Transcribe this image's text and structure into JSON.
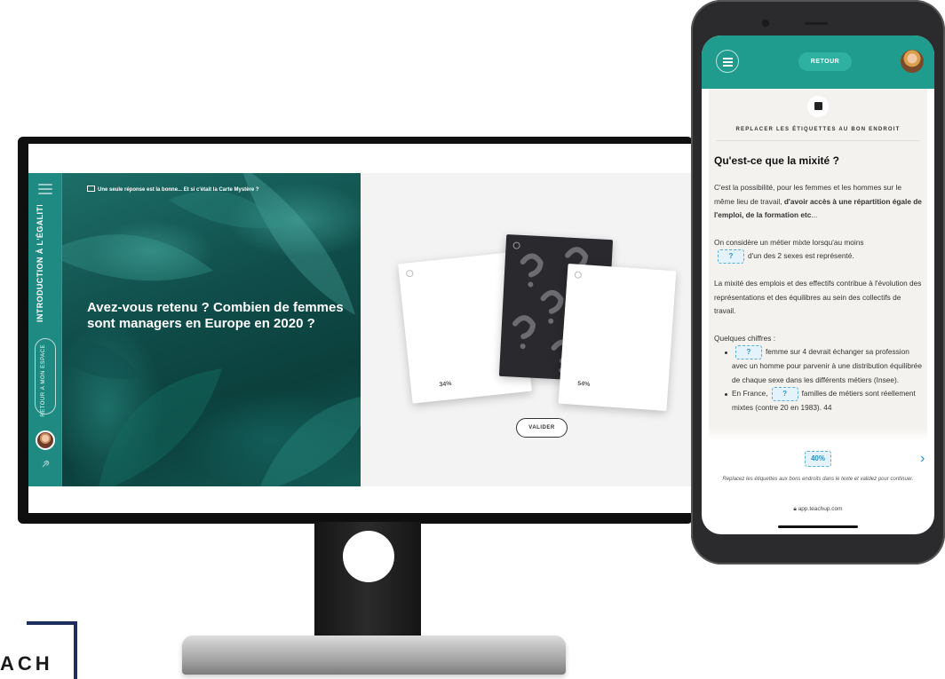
{
  "monitor": {
    "sidebar": {
      "course_title": "INTRODUCTION À L'ÉGALITÉ ...",
      "return_label": "RETOUR À MON ESPACE"
    },
    "slide": {
      "hint": "Une seule réponse est la bonne... Et si c'était la Carte Mystère ?",
      "question": "Avez-vous retenu ? Combien de femmes sont managers en Europe en 2020 ?"
    },
    "cards": [
      {
        "label": "34%"
      },
      {
        "label": "Carte Mystère"
      },
      {
        "label": "54%"
      }
    ],
    "validate_label": "VALIDER"
  },
  "phone": {
    "header": {
      "back_label": "RETOUR"
    },
    "activity_type": "REPLACER LES ÉTIQUETTES AU BON ENDROIT",
    "title": "Qu'est-ce que la mixité ?",
    "p1_a": "C'est la possibilité, pour les femmes et les hommes sur le même lieu de travail, ",
    "p1_b": "d'avoir accès à une répartition égale de l'emploi, de la formation etc",
    "p1_c": "...",
    "p2_a": "On considère un métier mixte lorsqu'au moins",
    "blank": "?",
    "p2_b": "d'un des 2 sexes est représenté.",
    "p3": "La mixité des emplois et des effectifs contribue à l'évolution des représentations et des équilibres au sein des collectifs de travail.",
    "p4": "Quelques chiffres :",
    "li1": "femme sur 4 devrait échanger sa profession avec un homme pour parvenir à une distribution équilibrée de chaque sexe dans les différents métiers (Insee).",
    "li2_a": "En France,",
    "li2_b": "familles de métiers sont réellement mixtes (contre 20 en 1983). 44",
    "tag": "40%",
    "instruction": "Replacez les étiquettes aux bons endroits dans le texte et validez pour continuer.",
    "url": "app.teachup.com"
  },
  "logo": {
    "text": "ACH"
  },
  "colors": {
    "teal": "#1f9c8e",
    "accent_blue": "#2a8ec2",
    "navy": "#1f2d5c"
  }
}
